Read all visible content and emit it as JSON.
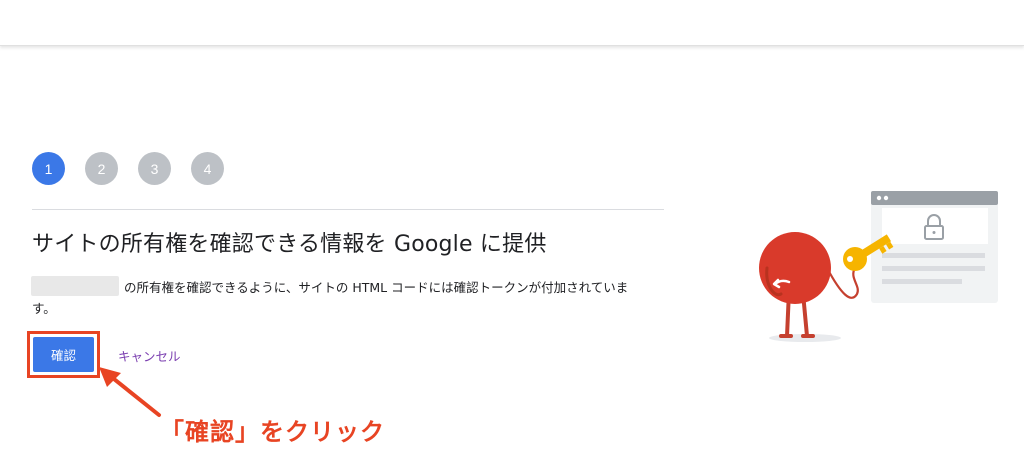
{
  "stepper": {
    "steps": [
      "1",
      "2",
      "3",
      "4"
    ],
    "active_step": 1
  },
  "main": {
    "title": "サイトの所有権を確認できる情報を Google に提供",
    "description_line1": "の所有権を確認できるように、サイトの HTML コードには確認トークンが付加されていま",
    "description_line2": "す。",
    "verify_label": "確認",
    "cancel_label": "キャンセル"
  },
  "annotation": {
    "text": "「確認」をクリック"
  },
  "colors": {
    "primary": "#3b78e7",
    "inactive_step": "#bdc1c6",
    "link": "#7b3fb0",
    "highlight": "#e84423"
  },
  "illustration": {
    "icons": [
      "browser-window-icon",
      "padlock-icon",
      "key-icon",
      "character-mascot"
    ]
  }
}
